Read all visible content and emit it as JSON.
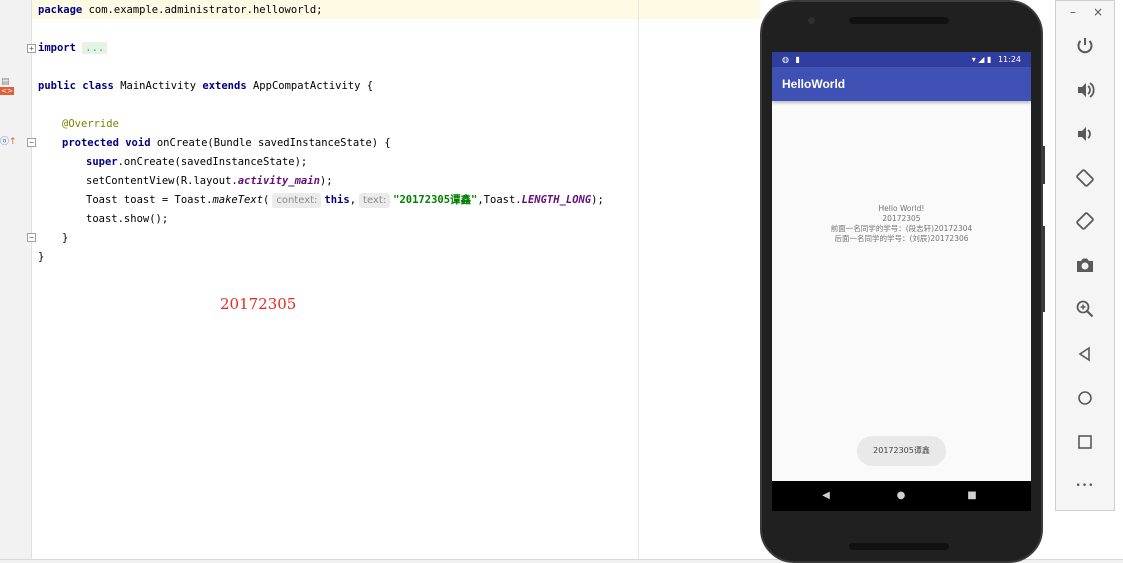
{
  "editor": {
    "line_package": {
      "kw": "package",
      "rest": " com.example.administrator.helloworld;"
    },
    "line_import": {
      "kw": "import",
      "dots": "..."
    },
    "line_class": {
      "kw1": "public",
      "kw2": "class",
      "name": "MainActivity",
      "kw3": "extends",
      "rest": "AppCompatActivity {"
    },
    "line_override": "@Override",
    "line_oncreate": {
      "kw1": "protected",
      "kw2": "void",
      "rest": "onCreate(Bundle savedInstanceState) {"
    },
    "line_super": {
      "kw": "super",
      "rest": ".onCreate(savedInstanceState);"
    },
    "line_setcontent": {
      "pre": "setContentView(R.layout.",
      "field": "activity_main",
      "post": ");"
    },
    "line_toast": {
      "pre": "Toast toast = Toast.",
      "method": "makeText",
      "paren": "(",
      "hint_context": "context:",
      "kw": "this",
      "comma1": ",",
      "hint_text": "text:",
      "string": "\"20172305谭鑫\"",
      "mid": ",Toast.",
      "field": "LENGTH_LONG",
      "post": ");"
    },
    "line_show": "toast.show();",
    "line_close_method": "}",
    "line_close_class": "}",
    "annotation_number": "20172305"
  },
  "emulator": {
    "status_time": "11:24",
    "app_title": "HelloWorld",
    "content_lines": [
      "Hello  World!",
      "20172305",
      "前面一名同学的学号：(段志轩)20172304",
      "后面一名同学的学号：(刘辰)20172306"
    ],
    "toast_text": "20172305谭鑫",
    "nav": {
      "back": "◀",
      "home": "●",
      "recents": "■"
    }
  },
  "toolbar": {
    "minimize": "–",
    "close": "×",
    "more": "•••"
  },
  "colors": {
    "status_bar": "#303f9f",
    "app_bar": "#3f51b5",
    "keyword": "#000080",
    "string": "#008000",
    "annotation": "#808000",
    "red_note": "#e8281e"
  }
}
